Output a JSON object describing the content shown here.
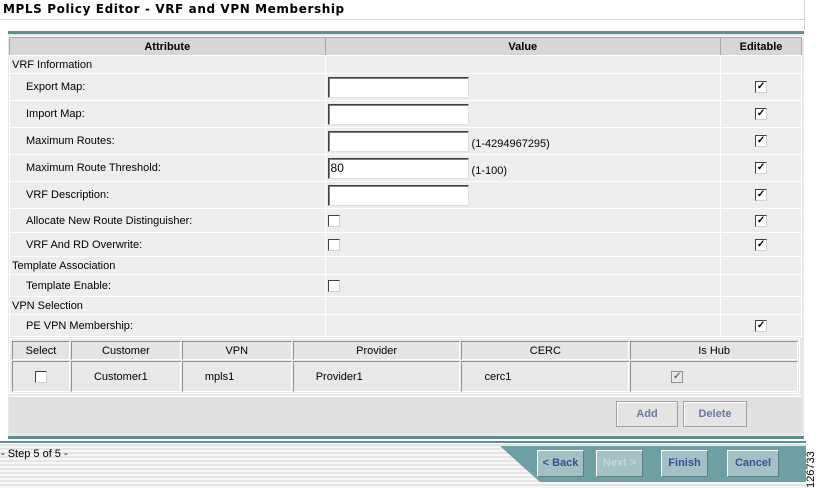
{
  "window": {
    "title": "MPLS Policy Editor - VRF and VPN Membership"
  },
  "table": {
    "headers": {
      "attribute": "Attribute",
      "value": "Value",
      "editable": "Editable"
    },
    "sections": {
      "vrf": "VRF Information",
      "template": "Template Association",
      "vpn": "VPN Selection"
    },
    "rows": [
      {
        "label": "Export Map:",
        "value": "",
        "hint": "",
        "editable": true
      },
      {
        "label": "Import Map:",
        "value": "",
        "hint": "",
        "editable": true
      },
      {
        "label": "Maximum Routes:",
        "value": "",
        "hint": "(1-4294967295)",
        "editable": true
      },
      {
        "label": "Maximum Route Threshold:",
        "value": "80",
        "hint": "(1-100)",
        "editable": true
      },
      {
        "label": "VRF Description:",
        "value": "",
        "hint": "",
        "editable": true
      },
      {
        "label": "Allocate New Route Distinguisher:",
        "checked": false,
        "editable": true
      },
      {
        "label": "VRF And RD Overwrite:",
        "checked": false,
        "editable": true
      },
      {
        "label": "Template Enable:",
        "checked": false,
        "editable": false
      },
      {
        "label": "PE VPN Membership:",
        "editable": true
      }
    ]
  },
  "vpn_table": {
    "headers": [
      "Select",
      "Customer",
      "VPN",
      "Provider",
      "CERC",
      "Is Hub"
    ],
    "rows": [
      {
        "select": false,
        "customer": "Customer1",
        "vpn": "mpls1",
        "provider": "Provider1",
        "cerc": "cerc1",
        "is_hub": true
      }
    ]
  },
  "buttons": {
    "add": "Add",
    "delete": "Delete"
  },
  "wizard": {
    "step": "- Step 5 of 5 -",
    "back": "< Back",
    "next": "Next >",
    "finish": "Finish",
    "cancel": "Cancel"
  },
  "figure_id": "126733",
  "check_glyph": "✓",
  "colors": {
    "accent": "#5f8e91",
    "button_text": "#3d4c96"
  }
}
